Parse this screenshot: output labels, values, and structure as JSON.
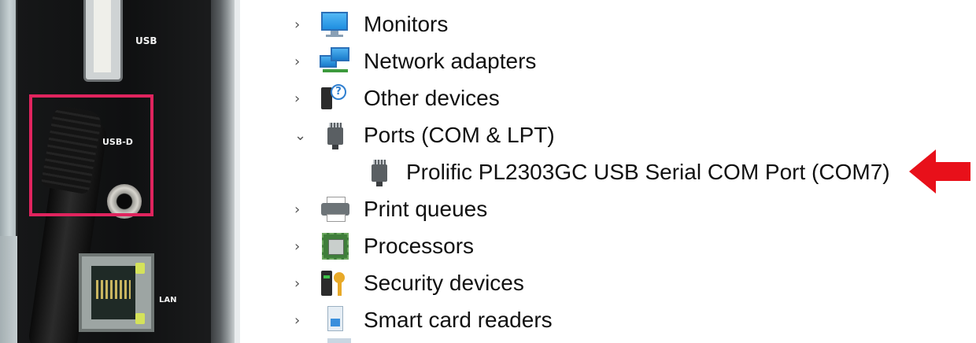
{
  "photo": {
    "labels": {
      "usb": "USB",
      "usb_d": "USB-D",
      "lan": "LAN"
    },
    "highlight_color": "#e0245e"
  },
  "device_tree": {
    "items": [
      {
        "label": "Monitors",
        "expanded": false,
        "icon": "monitor-icon"
      },
      {
        "label": "Network adapters",
        "expanded": false,
        "icon": "network-adapter-icon"
      },
      {
        "label": "Other devices",
        "expanded": false,
        "icon": "unknown-device-icon"
      },
      {
        "label": "Ports (COM & LPT)",
        "expanded": true,
        "icon": "port-connector-icon",
        "children": [
          {
            "label": "Prolific PL2303GC USB Serial COM Port (COM7)",
            "icon": "port-connector-icon"
          }
        ]
      },
      {
        "label": "Print queues",
        "expanded": false,
        "icon": "printer-icon"
      },
      {
        "label": "Processors",
        "expanded": false,
        "icon": "processor-chip-icon"
      },
      {
        "label": "Security devices",
        "expanded": false,
        "icon": "security-key-icon"
      },
      {
        "label": "Smart card readers",
        "expanded": false,
        "icon": "smart-card-icon"
      }
    ],
    "chevron_collapsed": "›",
    "chevron_expanded": "⌄"
  },
  "arrow_color": "#e8101a"
}
